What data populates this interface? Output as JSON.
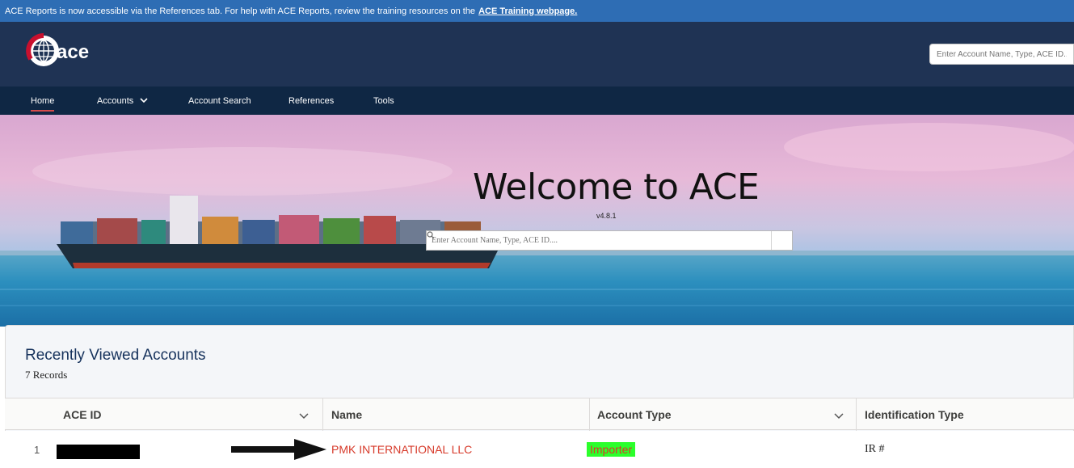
{
  "banner": {
    "text": "ACE Reports is now accessible via the References tab.  For help with ACE Reports, review the training resources on the",
    "link": "ACE Training webpage."
  },
  "header": {
    "logo_text": "ace",
    "search_placeholder": "Enter Account Name, Type, ACE ID...."
  },
  "nav": {
    "items": [
      {
        "label": "Home",
        "active": true
      },
      {
        "label": "Accounts",
        "active": false
      },
      {
        "label": "Account Search",
        "active": false
      },
      {
        "label": "References",
        "active": false
      },
      {
        "label": "Tools",
        "active": false
      }
    ]
  },
  "hero": {
    "title": "Welcome to ACE",
    "version": "v4.8.1",
    "search_placeholder": "Enter Account Name, Type, ACE ID...."
  },
  "recent": {
    "title": "Recently Viewed Accounts",
    "count": "7 Records",
    "columns": [
      "ACE ID",
      "Name",
      "Account Type",
      "Identification Type"
    ],
    "rows": [
      {
        "num": "1",
        "name": "PMK INTERNATIONAL LLC",
        "account_type": "Importer",
        "identification_type": "IR #"
      }
    ]
  },
  "colors": {
    "banner": "#2e6db4",
    "header": "#1f3354",
    "nav": "#0f2744",
    "link_red": "#d73a2a",
    "highlight": "#2bff2b"
  }
}
